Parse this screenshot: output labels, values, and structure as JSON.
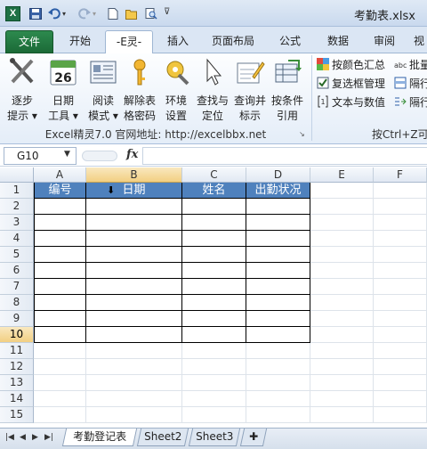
{
  "window": {
    "title": "考勤表.xlsx",
    "app_icon_letter": "X"
  },
  "quick_access": [
    "save-icon",
    "undo-icon",
    "redo-icon",
    "new-icon",
    "open-icon",
    "print-preview-icon",
    "customize-icon"
  ],
  "tabs": [
    "文件",
    "开始",
    "-E灵-",
    "插入",
    "页面布局",
    "公式",
    "数据",
    "审阅",
    "视"
  ],
  "ribbon": {
    "buttons": [
      {
        "line1": "逐步",
        "line2": "提示 ▾",
        "icon": "step-tools-icon"
      },
      {
        "line1": "日期",
        "line2": "工具 ▾",
        "icon": "calendar-icon",
        "date_num": "26"
      },
      {
        "line1": "阅读",
        "line2": "模式 ▾",
        "icon": "reading-mode-icon"
      },
      {
        "line1": "解除表",
        "line2": "格密码",
        "icon": "key-icon"
      },
      {
        "line1": "环境",
        "line2": "设置",
        "icon": "settings-tools-icon"
      },
      {
        "line1": "查找与",
        "line2": "定位",
        "icon": "cursor-icon"
      },
      {
        "line1": "查询并",
        "line2": "标示",
        "icon": "highlight-icon"
      },
      {
        "line1": "按条件",
        "line2": "引用",
        "icon": "reference-icon"
      }
    ],
    "group_label": "Excel精灵7.0 官网地址: http://excelbbx.net",
    "group2_label": "按Ctrl+Z可",
    "small_items": [
      "按颜色汇总",
      "复选框管理",
      "文本与数值"
    ],
    "small_items2": [
      "批量",
      "隔行",
      "隔行"
    ]
  },
  "formula_bar": {
    "name_box": "G10",
    "fx": "fx",
    "formula": ""
  },
  "grid": {
    "columns": [
      "A",
      "B",
      "C",
      "D",
      "E",
      "F"
    ],
    "rows": [
      "1",
      "2",
      "3",
      "4",
      "5",
      "6",
      "7",
      "8",
      "9",
      "10",
      "11",
      "12",
      "13",
      "14",
      "15"
    ],
    "selected_column": "B",
    "selected_row": "10",
    "header_cells": [
      "编号",
      "日期",
      "姓名",
      "出勤状况"
    ],
    "colors": {
      "header_fill": "#4f81bd",
      "header_text": "#ffffff"
    }
  },
  "sheets": [
    "考勤登记表",
    "Sheet2",
    "Sheet3"
  ]
}
